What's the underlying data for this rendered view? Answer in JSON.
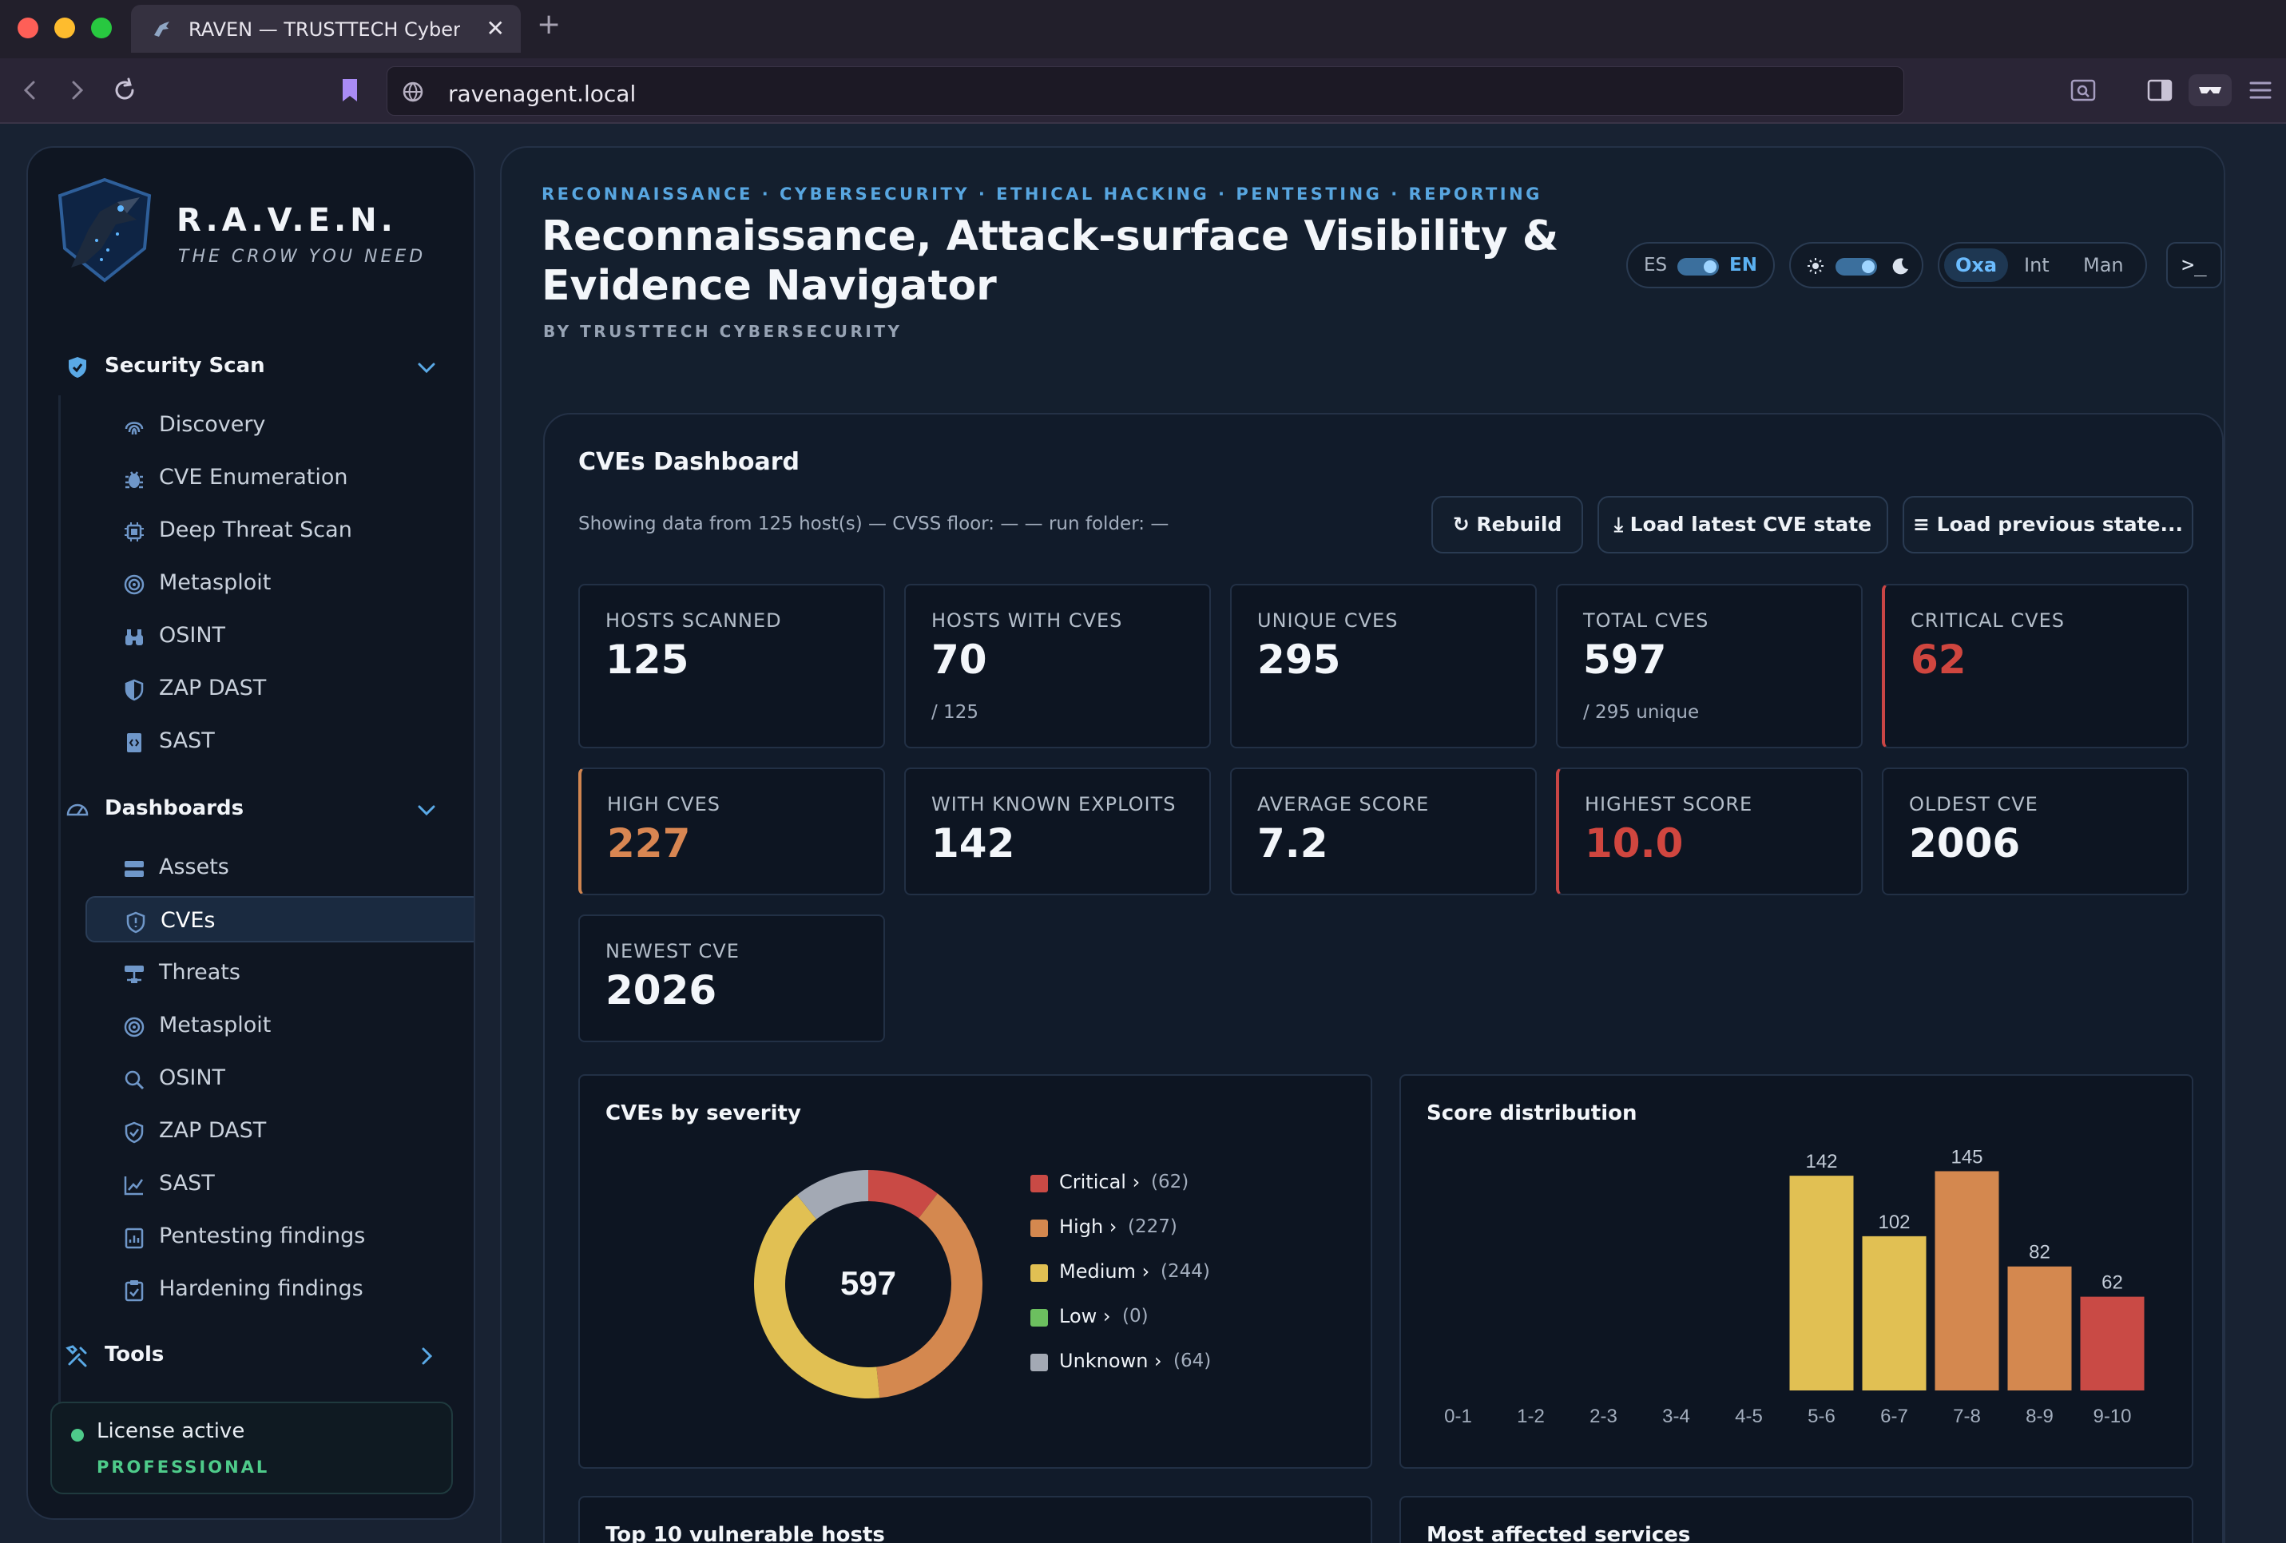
{
  "browser": {
    "tab_title": "RAVEN — TRUSTTECH Cybersecurity",
    "new_tab": "+",
    "close": "✕",
    "url": "ravenagent.local"
  },
  "brand": {
    "name": "R.A.V.E.N.",
    "tagline": "THE CROW YOU NEED"
  },
  "sidebar": {
    "sections": [
      {
        "label": "Security Scan",
        "items": [
          "Discovery",
          "CVE Enumeration",
          "Deep Threat Scan",
          "Metasploit",
          "OSINT",
          "ZAP DAST",
          "SAST"
        ]
      },
      {
        "label": "Dashboards",
        "items": [
          "Assets",
          "CVEs",
          "Threats",
          "Metasploit",
          "OSINT",
          "ZAP DAST",
          "SAST",
          "Pentesting findings",
          "Hardening findings"
        ]
      },
      {
        "label": "Tools",
        "items": []
      }
    ],
    "active_item": "CVEs",
    "license": {
      "status": "License active",
      "plan": "PROFESSIONAL"
    }
  },
  "header": {
    "breadcrumb": "RECONNAISSANCE · CYBERSECURITY · ETHICAL HACKING · PENTESTING · REPORTING",
    "title": "Reconnaissance, Attack-surface Visibility & Evidence Navigator",
    "byline": "BY TRUSTTECH CYBERSECURITY",
    "lang": {
      "left": "ES",
      "right": "EN",
      "selected": "EN"
    },
    "theme": {
      "selected": "dark"
    },
    "modes": [
      "Oxa",
      "Int",
      "Man"
    ],
    "mode_selected": "Oxa",
    "terminal_label": ">_"
  },
  "dashboard": {
    "title": "CVEs Dashboard",
    "subtitle": "Showing data from 125 host(s) — CVSS floor: — — run folder: —",
    "buttons": {
      "rebuild": "↻ Rebuild",
      "load_latest": "⤓ Load latest CVE state",
      "load_previous": "≡ Load previous state..."
    },
    "stats": [
      {
        "label": "HOSTS SCANNED",
        "value": "125",
        "sub": ""
      },
      {
        "label": "HOSTS WITH CVES",
        "value": "70",
        "sub": "/ 125"
      },
      {
        "label": "UNIQUE CVES",
        "value": "295",
        "sub": ""
      },
      {
        "label": "TOTAL CVES",
        "value": "597",
        "sub": "/ 295 unique"
      },
      {
        "label": "CRITICAL CVES",
        "value": "62",
        "sub": ""
      },
      {
        "label": "HIGH CVES",
        "value": "227",
        "sub": ""
      },
      {
        "label": "WITH KNOWN EXPLOITS",
        "value": "142",
        "sub": ""
      },
      {
        "label": "AVERAGE SCORE",
        "value": "7.2",
        "sub": ""
      },
      {
        "label": "HIGHEST SCORE",
        "value": "10.0",
        "sub": ""
      },
      {
        "label": "OLDEST CVE",
        "value": "2006",
        "sub": ""
      },
      {
        "label": "NEWEST CVE",
        "value": "2026",
        "sub": ""
      }
    ],
    "severity_panel_title": "CVEs by severity",
    "score_panel_title": "Score distribution",
    "bottom_panels": [
      "Top 10 vulnerable hosts",
      "Most affected services"
    ]
  },
  "chart_data": [
    {
      "type": "pie",
      "title": "CVEs by severity",
      "center_label": "597",
      "categories": [
        "Critical",
        "High",
        "Medium",
        "Low",
        "Unknown"
      ],
      "values": [
        62,
        227,
        244,
        0,
        64
      ],
      "legend_labels": [
        "Critical ›",
        "High ›",
        "Medium ›",
        "Low ›",
        "Unknown ›"
      ],
      "legend_counts": [
        "(62)",
        "(227)",
        "(244)",
        "(0)",
        "(64)"
      ],
      "colors": [
        "#c94a45",
        "#d4884f",
        "#e1c053",
        "#6cbf5f",
        "#a3a9b4"
      ],
      "legend_position": "right"
    },
    {
      "type": "bar",
      "title": "Score distribution",
      "categories": [
        "0-1",
        "1-2",
        "2-3",
        "3-4",
        "4-5",
        "5-6",
        "6-7",
        "7-8",
        "8-9",
        "9-10"
      ],
      "values": [
        0,
        0,
        0,
        0,
        0,
        142,
        102,
        145,
        82,
        62
      ],
      "data_labels": [
        "",
        "",
        "",
        "",
        "",
        "142",
        "102",
        "145",
        "82",
        "62"
      ],
      "colors": [
        "#e1c053",
        "#e1c053",
        "#e1c053",
        "#e1c053",
        "#e1c053",
        "#e1c053",
        "#e1c053",
        "#d4884f",
        "#d4884f",
        "#c94a45"
      ],
      "ylim": [
        0,
        150
      ],
      "grid": false
    }
  ]
}
